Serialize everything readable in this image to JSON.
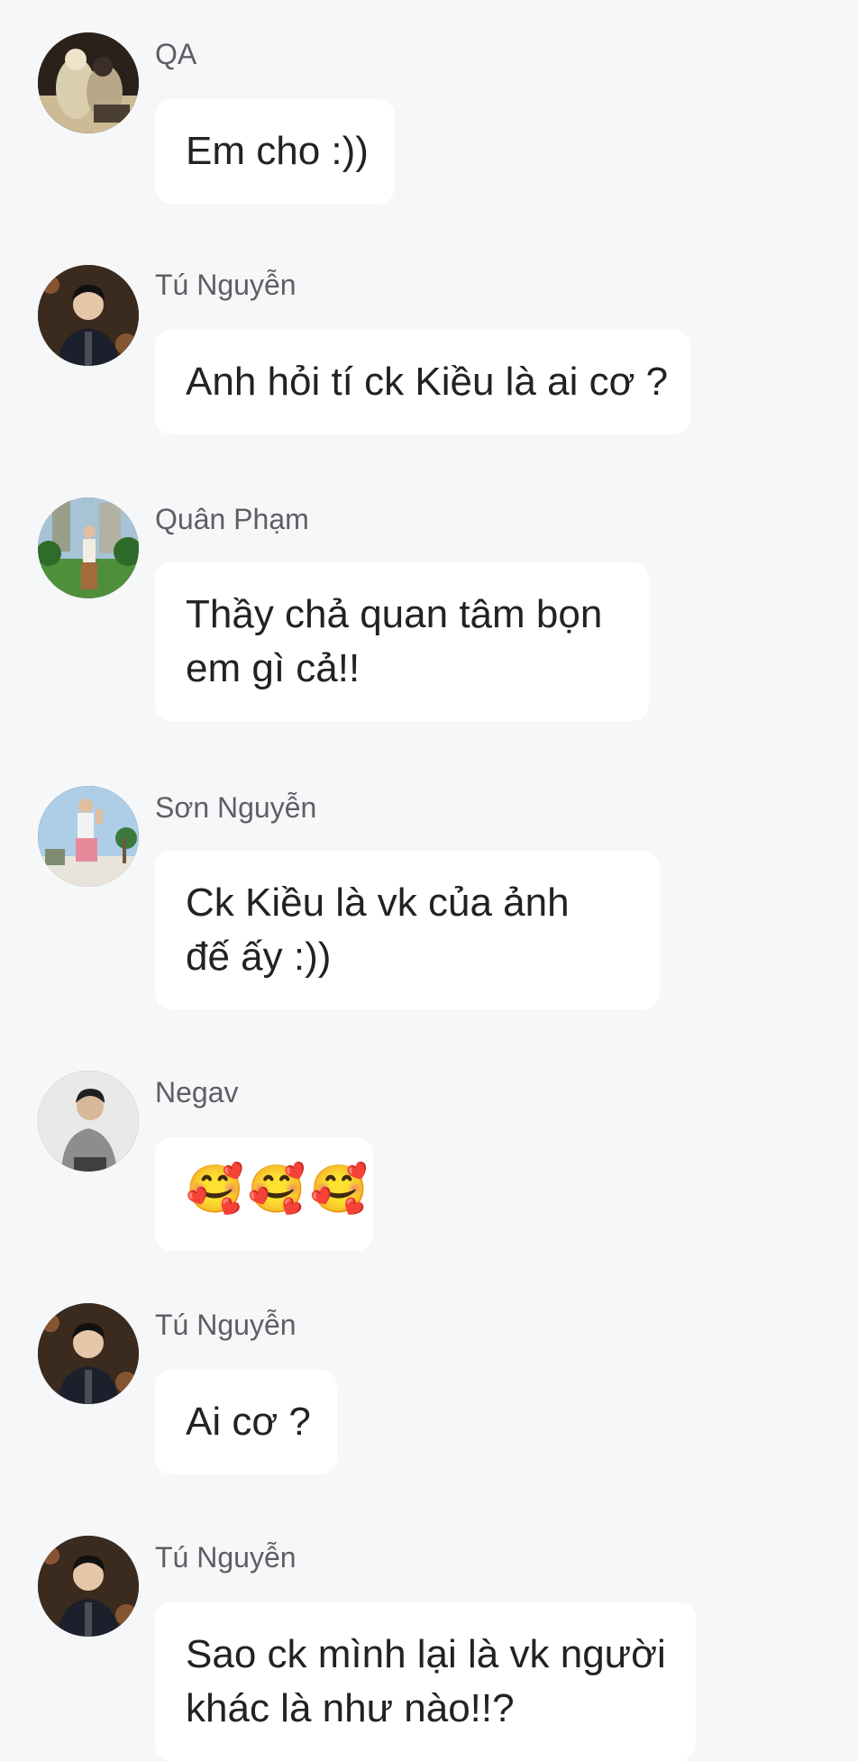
{
  "messages": [
    {
      "sender": "QA",
      "avatar": "avatar-qa",
      "lines": [
        "Em cho :))"
      ]
    },
    {
      "sender": "Tú Nguyễn",
      "avatar": "avatar-tu-nguyen",
      "lines": [
        "Anh hỏi tí ck Kiều là ai cơ ?"
      ]
    },
    {
      "sender": "Quân Phạm",
      "avatar": "avatar-quan-pham",
      "lines": [
        "Thầy chả quan tâm bọn",
        "em gì cả!!"
      ]
    },
    {
      "sender": "Sơn Nguyễn",
      "avatar": "avatar-son-nguyen",
      "lines": [
        "Ck Kiều là vk của ảnh",
        "đế ấy :))"
      ]
    },
    {
      "sender": "Negav",
      "avatar": "avatar-negav",
      "lines": [
        "🥰🥰🥰"
      ]
    },
    {
      "sender": "Tú Nguyễn",
      "avatar": "avatar-tu-nguyen",
      "lines": [
        "Ai cơ ?"
      ]
    },
    {
      "sender": "Tú Nguyễn",
      "avatar": "avatar-tu-nguyen",
      "lines": [
        "Sao ck mình lại là vk người",
        "khác là như nào!!?"
      ]
    }
  ],
  "colors": {
    "background": "#f6f7f9",
    "bubble": "#ffffff",
    "sender_text": "#5d5f63",
    "message_text": "#222222"
  }
}
